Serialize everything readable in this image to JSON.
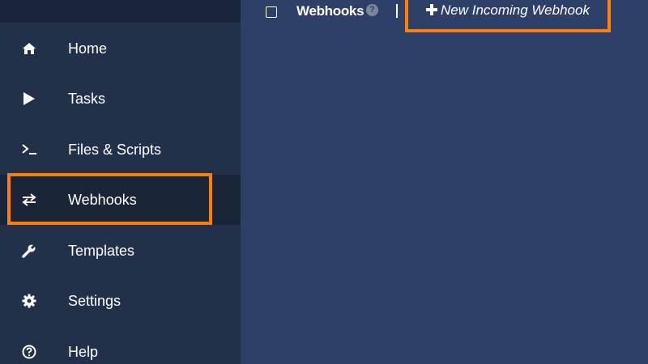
{
  "sidebar": {
    "items": [
      {
        "label": "Home",
        "icon": "home-icon"
      },
      {
        "label": "Tasks",
        "icon": "play-icon"
      },
      {
        "label": "Files & Scripts",
        "icon": "terminal-icon"
      },
      {
        "label": "Webhooks",
        "icon": "arrows-exchange-icon",
        "active": true
      },
      {
        "label": "Templates",
        "icon": "wrench-icon"
      },
      {
        "label": "Settings",
        "icon": "gear-icon"
      },
      {
        "label": "Help",
        "icon": "question-circle-icon"
      }
    ]
  },
  "header": {
    "title": "Webhooks",
    "help_icon": "?",
    "new_button_label": "New Incoming Webhook"
  },
  "colors": {
    "sidebar_bg": "#22304a",
    "main_bg": "#2f4068",
    "active_item_bg": "#1b2538",
    "highlight": "#ff7f0e",
    "text": "#ffffff"
  }
}
